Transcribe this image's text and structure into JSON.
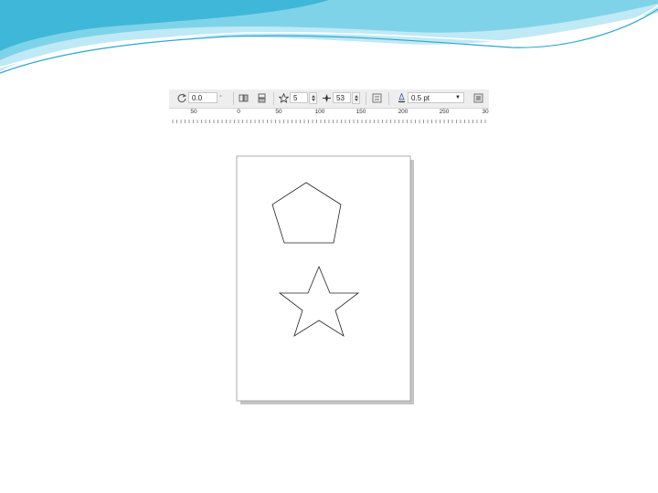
{
  "slide_theme": {
    "wave_colors": [
      "#3fb7d8",
      "#7fd3e8",
      "#bfe9f4"
    ]
  },
  "toolbar": {
    "rotation_value": "0.0",
    "star_points_value": "5",
    "sharpness_value": "53",
    "outline_width_value": "0.5 pt"
  },
  "ruler": {
    "labels": [
      "50",
      "0",
      "50",
      "100",
      "150",
      "200",
      "250",
      "30"
    ]
  },
  "canvas": {
    "shapes": [
      "pentagon",
      "star"
    ]
  }
}
